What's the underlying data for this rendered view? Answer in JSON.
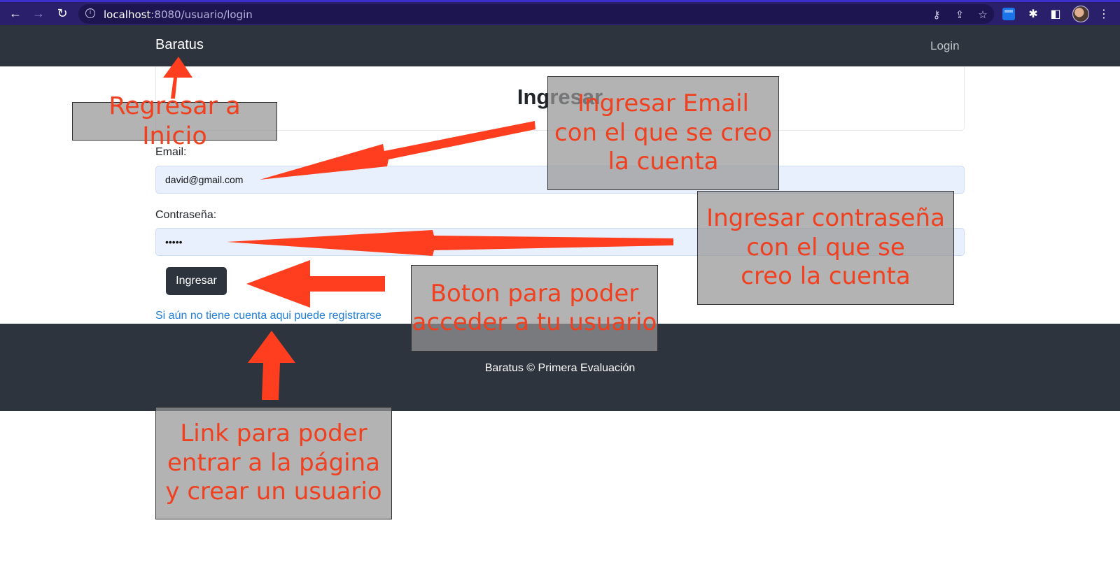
{
  "browser": {
    "url_host": "localhost",
    "url_path": ":8080/usuario/login"
  },
  "navbar": {
    "brand": "Baratus",
    "login_label": "Login"
  },
  "form": {
    "title": "Ingresar",
    "email_label": "Email:",
    "email_value": "david@gmail.com",
    "password_label": "Contraseña:",
    "password_value": "•••••",
    "submit_label": "Ingresar",
    "register_link": "Si aún no tiene cuenta aqui puede registrarse"
  },
  "footer": {
    "text": "Baratus © Primera Evaluación"
  },
  "annotations": {
    "home": "Regresar a Inicio",
    "email_l1": "Ingresar Email",
    "email_l2": "con el que se creo",
    "email_l3": "la cuenta",
    "password_l1": "Ingresar contraseña",
    "password_l2": "con el que se",
    "password_l3": "creo la cuenta",
    "button_l1": "Boton para poder",
    "button_l2": "acceder a tu usuario",
    "link_l1": "Link para poder",
    "link_l2": "entrar a la página",
    "link_l3": "y crear un usuario",
    "color": "#f0401f"
  }
}
